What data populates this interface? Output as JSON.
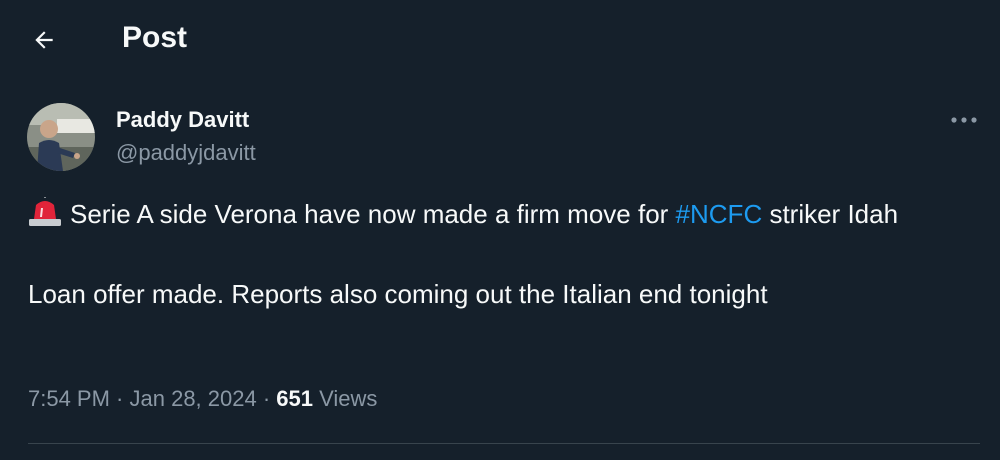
{
  "header": {
    "title": "Post"
  },
  "author": {
    "name": "Paddy Davitt",
    "handle": "@paddyjdavitt"
  },
  "tweet": {
    "line1_before": "Serie A side Verona have now made a firm move for ",
    "hashtag": "#NCFC",
    "line1_after": " striker Idah",
    "line2": "Loan offer made. Reports also coming out the Italian end tonight"
  },
  "meta": {
    "time": "7:54 PM",
    "separator1": " · ",
    "date": "Jan 28, 2024",
    "separator2": " · ",
    "views_count": "651",
    "views_label": " Views"
  },
  "icons": {
    "back": "arrow-left-icon",
    "more": "more-horizontal-icon",
    "siren": "police-light-emoji"
  },
  "colors": {
    "background": "#15202b",
    "text": "#f7f9f9",
    "secondary_text": "#8b98a5",
    "link": "#1d9bf0",
    "divider": "#38444d"
  }
}
